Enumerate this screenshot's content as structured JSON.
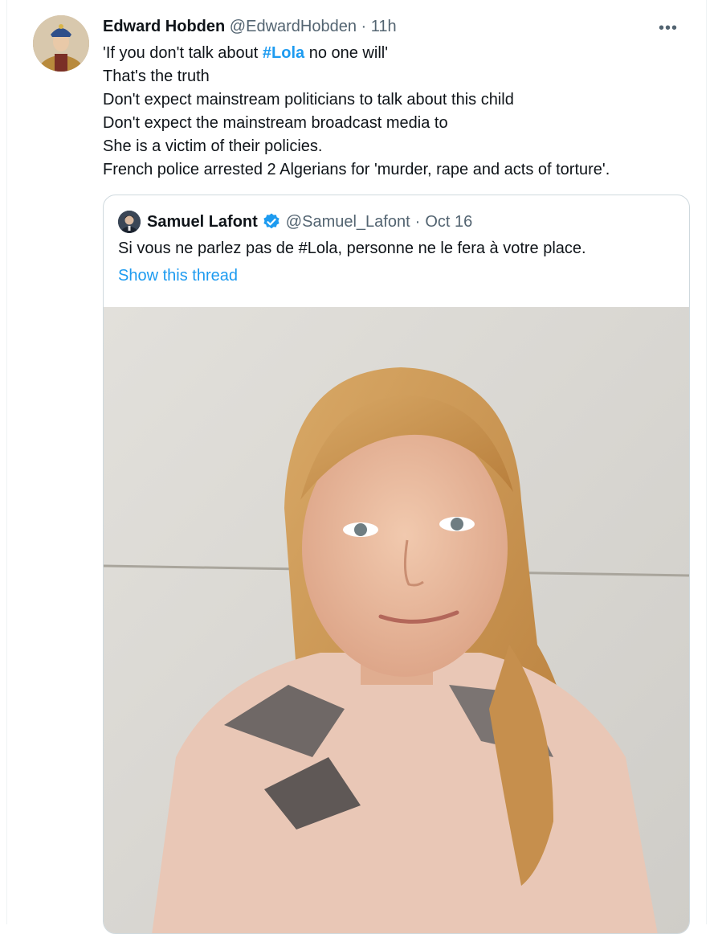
{
  "tweet": {
    "author_name": "Edward Hobden",
    "author_handle": "@EdwardHobden",
    "separator": "·",
    "time": "11h",
    "more_label": "•••",
    "lines": [
      {
        "before": "'If you don't talk about ",
        "hashtag": "#Lola",
        "after": " no one will'"
      },
      {
        "text": "That's the truth"
      },
      {
        "text": "Don't expect mainstream politicians to talk about this child"
      },
      {
        "text": "Don't expect the mainstream broadcast media to"
      },
      {
        "text": "She is a victim of their policies."
      },
      {
        "text": "French police arrested 2 Algerians for 'murder, rape and acts of torture'."
      }
    ]
  },
  "quoted": {
    "author_name": "Samuel Lafont",
    "author_handle": "@Samuel_Lafont",
    "separator": "·",
    "time": "Oct 16",
    "text": "Si vous ne parlez pas de #Lola, personne ne le fera à votre place.",
    "show_thread": "Show this thread"
  },
  "colors": {
    "accent": "#1d9bf0",
    "text": "#0f1419",
    "secondary": "#536471",
    "border": "#cfd9de"
  },
  "icons": {
    "more": "more-horizontal-icon",
    "verified": "verified-badge-icon"
  }
}
